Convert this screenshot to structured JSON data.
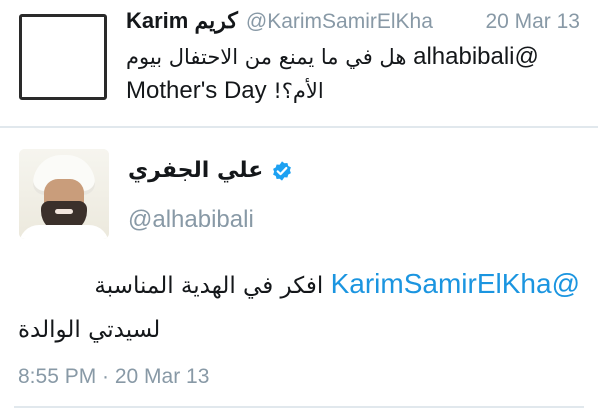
{
  "reply_tweet": {
    "name": "Karim كريم",
    "handle": "@KarimSamirElKha",
    "time": "20 Mar 13",
    "mention": "@alhabibali",
    "text_line1": "هل في ما يمنع من الاحتفال بيوم",
    "text_line2_latin": "Mother's Day",
    "text_line2_arabic": "الأم؟!"
  },
  "main_tweet": {
    "author_name": "علي الجفري",
    "verified": true,
    "verified_icon": "verified-badge-icon",
    "handle": "@alhabibali",
    "mention": "@KarimSamirElKha",
    "text_line1": "افكر في الهدية المناسبة",
    "text_line2": "لسيدتي الوالدة",
    "timestamp": "8:55 PM · 20 Mar 13"
  },
  "colors": {
    "link": "#1b95e0",
    "secondary_text": "#8899a6",
    "primary_text": "#14171a",
    "verified": "#1da1f2",
    "divider": "#e1e8ed"
  }
}
